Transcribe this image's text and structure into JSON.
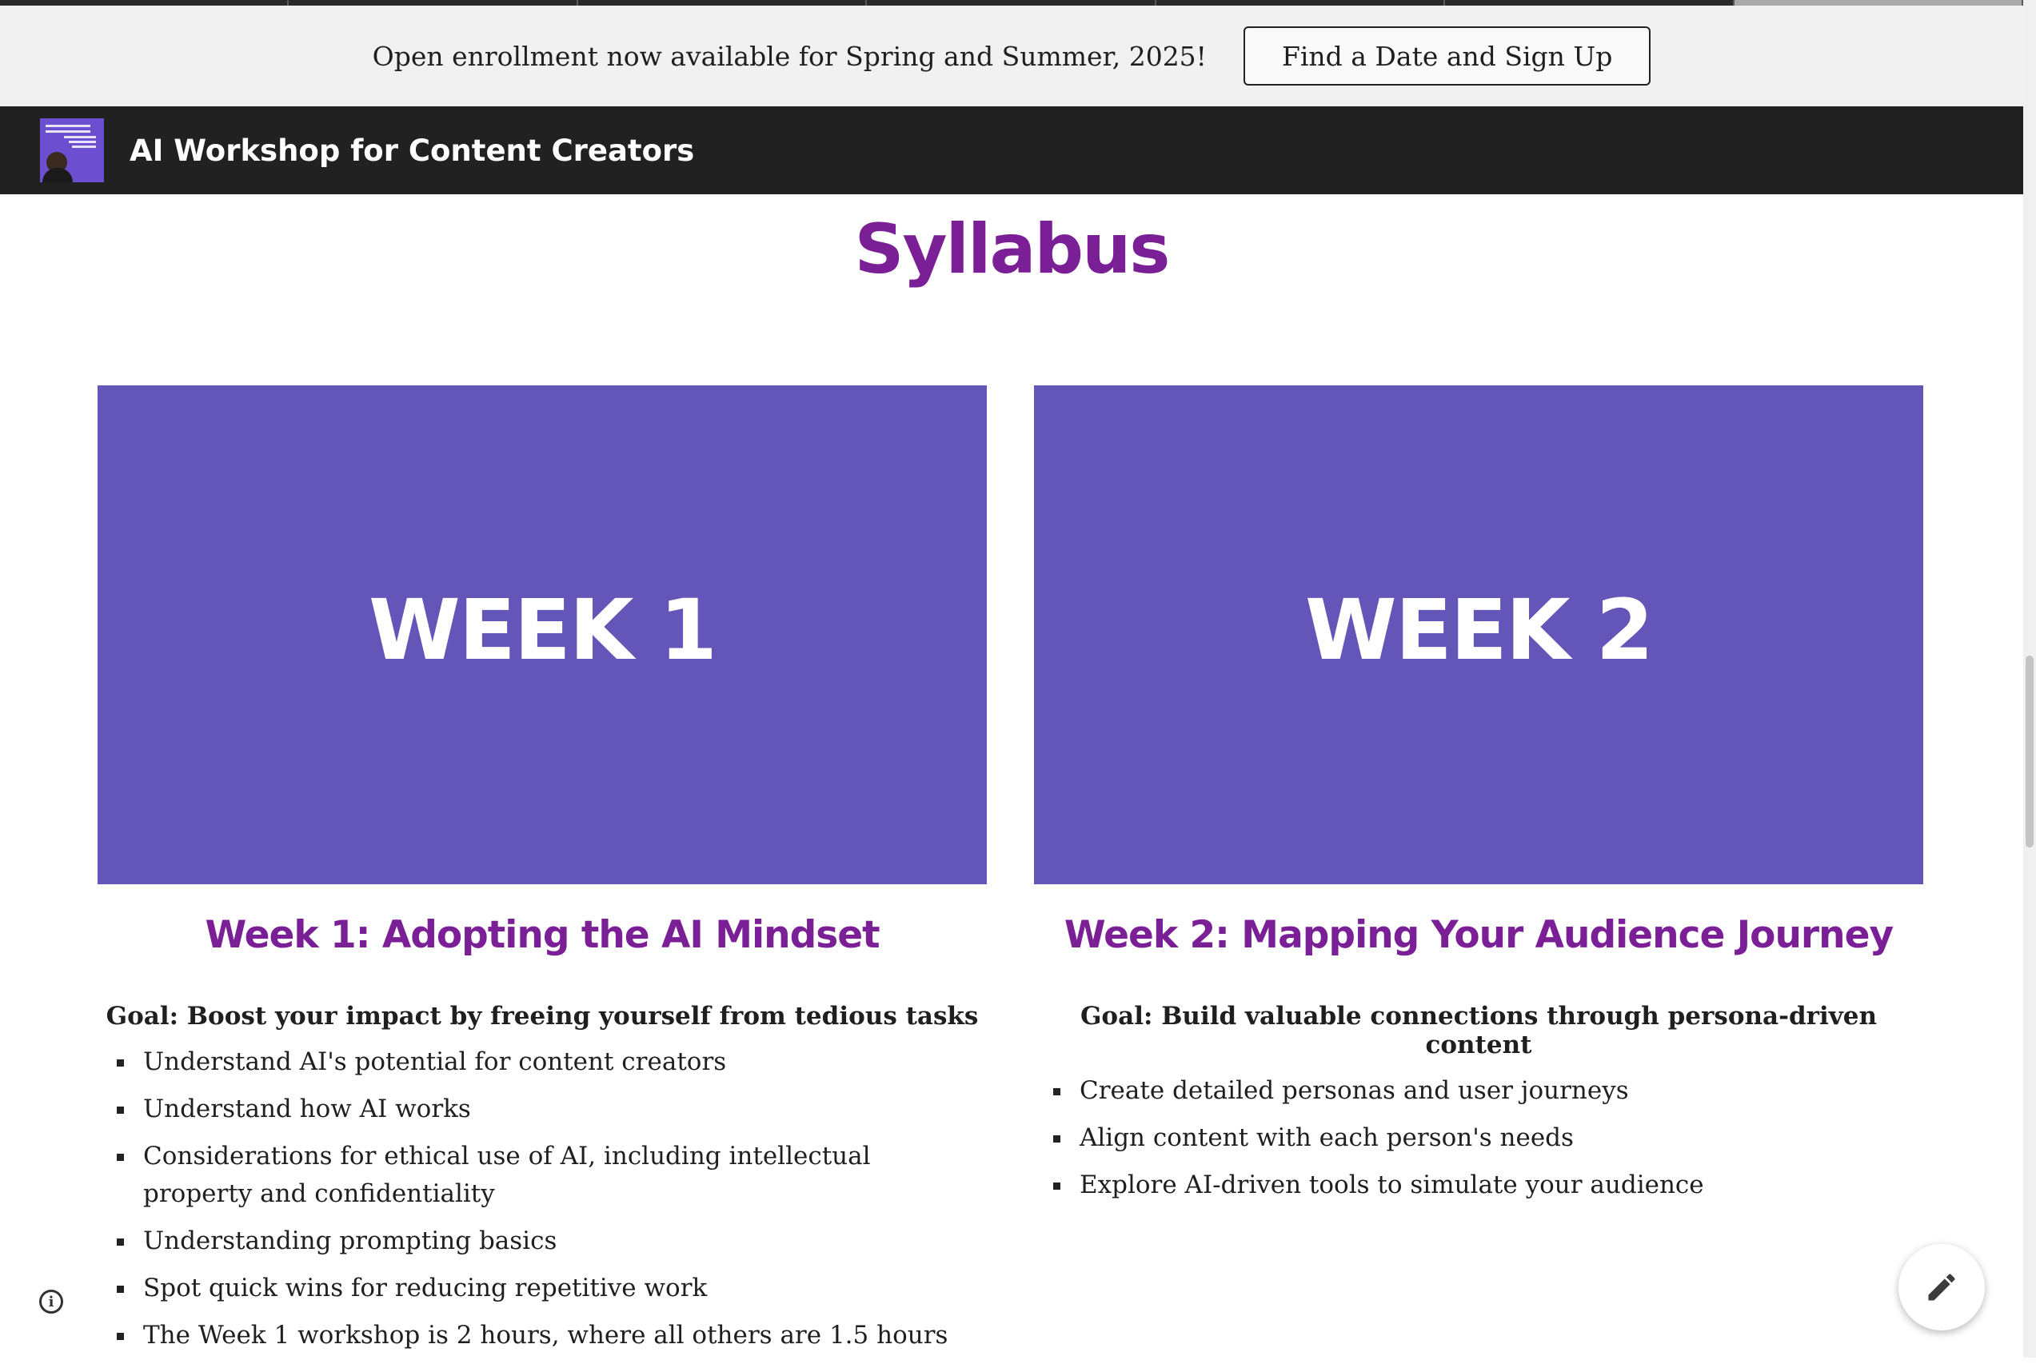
{
  "announcement": {
    "text": "Open enrollment now available for Spring and Summer, 2025!",
    "button_label": "Find a Date and Sign Up"
  },
  "header": {
    "site_title": "AI Workshop for Content Creators",
    "logo_icon": "workshop-logo"
  },
  "main": {
    "title": "Syllabus",
    "weeks": [
      {
        "banner": "WEEK 1",
        "heading": "Week 1: Adopting the AI Mindset",
        "goal": "Goal: Boost your impact by freeing yourself from tedious tasks",
        "items": [
          "Understand AI's potential for content creators",
          "Understand how AI works",
          "Considerations for ethical use of AI, including intellectual property and confidentiality",
          "Understanding prompting basics",
          "Spot quick wins for reducing repetitive work",
          "The Week 1 workshop is 2 hours, where all others are 1.5 hours"
        ]
      },
      {
        "banner": "WEEK 2",
        "heading": "Week 2: Mapping Your Audience Journey",
        "goal": "Goal: Build valuable connections through persona-driven content",
        "items": [
          "Create detailed personas and user journeys",
          "Align content with each person's needs",
          "Explore AI-driven tools to simulate your audience"
        ]
      }
    ]
  },
  "icons": {
    "info": "info-icon",
    "edit": "pencil-icon"
  },
  "colors": {
    "accent_purple": "#7b1f96",
    "banner_purple": "#6456b8",
    "header_bg": "#212121",
    "announcement_bg": "#f1f1f1"
  }
}
